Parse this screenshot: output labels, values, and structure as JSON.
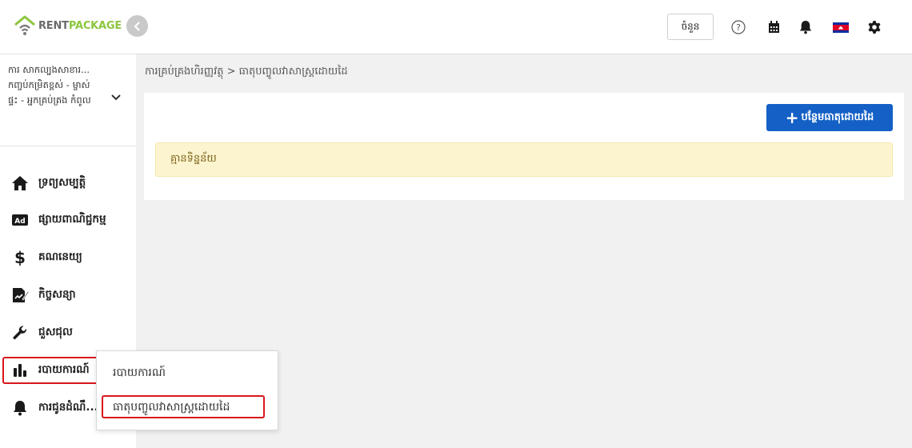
{
  "logo": {
    "rent": "RENT",
    "package": "PACKAGE"
  },
  "company": {
    "name": "ការ សាកល្បងសាខារ... កញ្ចប់កម្រិតខ្ពស់ - ម្ចាស់ផ្ទះ - អ្នកគ្រប់គ្រង កំពូល"
  },
  "menu": [
    {
      "label": "ទ្រព្យសម្បត្តិ",
      "icon": "home-icon"
    },
    {
      "label": "ផ្សាយពាណិជ្ជកម្ម",
      "icon": "ad-icon"
    },
    {
      "label": "គណនេយ្យ",
      "icon": "dollar-icon"
    },
    {
      "label": "កិច្ចសន្យា",
      "icon": "contract-icon"
    },
    {
      "label": "ជួសជុល",
      "icon": "wrench-icon"
    },
    {
      "label": "របាយការណ៍",
      "icon": "chart-bar-icon"
    },
    {
      "label": "ការជូនដំណឹ...",
      "icon": "bell-icon"
    }
  ],
  "submenu": [
    {
      "label": "របាយការណ៍"
    },
    {
      "label": "ធាតុបញ្ចូលវាសាស្ត្រដោយដៃ"
    }
  ],
  "topbar": {
    "branch_label": "ចំនួន"
  },
  "breadcrumb": "ការគ្រប់គ្រងហិរញ្ញវត្ថុ > ធាតុបញ្ចូលវាសាស្ត្រដោយដៃ",
  "main": {
    "add_button": "បន្ថែមធាតុដោយដៃ",
    "empty_message": "គ្មានទិន្នន័យ"
  },
  "colors": {
    "accent": "#1460c6",
    "brand_green": "#8cc63f",
    "highlight_red": "#d9161c",
    "alert_bg": "#fcf4cf"
  }
}
